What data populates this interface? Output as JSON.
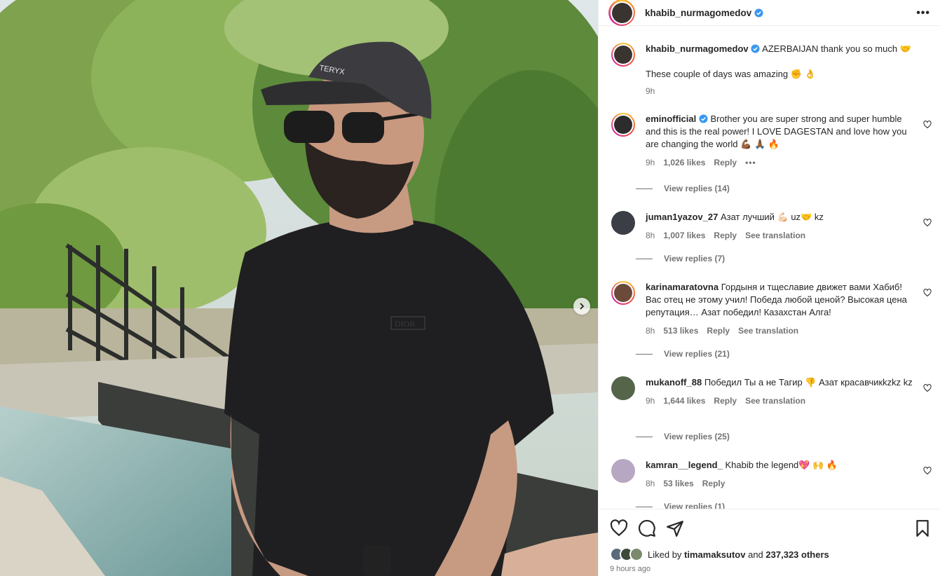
{
  "post": {
    "username": "khabib_nurmagomedov",
    "caption_line1": "AZERBAIJAN thank you so much 🤝",
    "caption_line2": "These couple of days was amazing ✊ 👌",
    "caption_time": "9h",
    "liked_by_prefix": "Liked by",
    "liked_by_user": "timamaksutov",
    "liked_by_and": "and",
    "liked_by_count": "237,323 others",
    "time_ago": "9 hours ago"
  },
  "comments": [
    {
      "username": "eminofficial",
      "verified": true,
      "text": "Brother you are super strong and super humble and this is the real power! I LOVE DAGESTAN and love how you are changing the world 💪🏾 🙏🏾 🔥",
      "time": "9h",
      "likes": "1,026 likes",
      "reply": "Reply",
      "see_translation": "",
      "view_replies": "View replies (14)"
    },
    {
      "username": "juman1yazov_27",
      "verified": false,
      "text": "Азат лучший 💪🏻 uz🤝 kz",
      "time": "8h",
      "likes": "1,007 likes",
      "reply": "Reply",
      "see_translation": "See translation",
      "view_replies": "View replies (7)"
    },
    {
      "username": "karinamaratovna",
      "verified": false,
      "text": "Гордыня и тщеславие движет вами Хабиб! Вас отец не этому учил! Победа любой ценой? Высокая цена репутация… Азат победил! Казахстан Алга!",
      "time": "8h",
      "likes": "513 likes",
      "reply": "Reply",
      "see_translation": "See translation",
      "view_replies": "View replies (21)"
    },
    {
      "username": "mukanoff_88",
      "verified": false,
      "text": "Победил Ты а не Тагир 👎 Азат красавчикkzkz kz",
      "time": "9h",
      "likes": "1,644 likes",
      "reply": "Reply",
      "see_translation": "See translation",
      "view_replies": "View replies (25)"
    },
    {
      "username": "kamran__legend_",
      "verified": false,
      "text": "Khabib the legend💖 🙌 🔥",
      "time": "8h",
      "likes": "53 likes",
      "reply": "Reply",
      "see_translation": "",
      "view_replies": "View replies (1)"
    }
  ],
  "icons": {
    "like": "heart-icon",
    "comment": "comment-icon",
    "share": "share-icon",
    "save": "bookmark-icon",
    "more": "more-options-icon",
    "next": "chevron-right-icon",
    "verified": "verified-badge-icon"
  },
  "colors": {
    "verified_blue": "#3897f0",
    "text_primary": "#262626",
    "text_secondary": "#737373",
    "divider": "#efefef"
  }
}
